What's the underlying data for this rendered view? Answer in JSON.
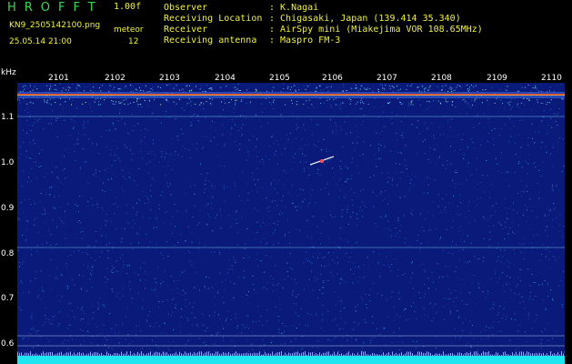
{
  "brand": {
    "text": "HROFFT",
    "version": "1.00f"
  },
  "file": {
    "name": "KN9_2505142100.png",
    "datetime": "25.05.14 21:00"
  },
  "meteor": {
    "label": "meteor",
    "count": "12"
  },
  "info": {
    "rows": [
      {
        "label": "Observer",
        "value": ": K.Nagai"
      },
      {
        "label": "Receiving Location",
        "value": ": Chigasaki, Japan (139.414 35.340)"
      },
      {
        "label": "Receiver",
        "value": ": AirSpy mini (Miakejima VOR 108.65MHz)"
      },
      {
        "label": "Receiving antenna",
        "value": ": Maspro FM-3"
      }
    ]
  },
  "axis": {
    "unit": "kHz",
    "x_ticks": [
      "2101",
      "2102",
      "2103",
      "2104",
      "2105",
      "2106",
      "2107",
      "2108",
      "2109",
      "2110"
    ],
    "y_ticks": [
      "1.1",
      "1.0",
      "0.9",
      "0.8",
      "0.7",
      "0.6"
    ]
  },
  "colors": {
    "yellow": "#f2f23a",
    "green": "#3ad94a",
    "background": "#0a1a7a"
  }
}
